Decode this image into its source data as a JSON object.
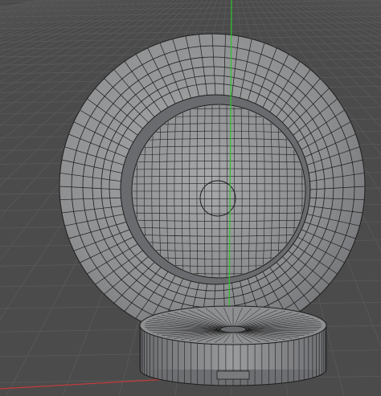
{
  "viewport": {
    "background_color": "#4b4b4b",
    "grid_color": "#5a5a5a",
    "mesh_face_color": "#8e8f91",
    "mesh_edge_color": "#1e1e1e",
    "y_axis_color": "#2ec42e",
    "x_axis_color": "#c83a3a"
  },
  "objects": [
    {
      "name": "dish-mesh",
      "type": "polygon-object"
    },
    {
      "name": "stand-base-mesh",
      "type": "polygon-object"
    }
  ]
}
